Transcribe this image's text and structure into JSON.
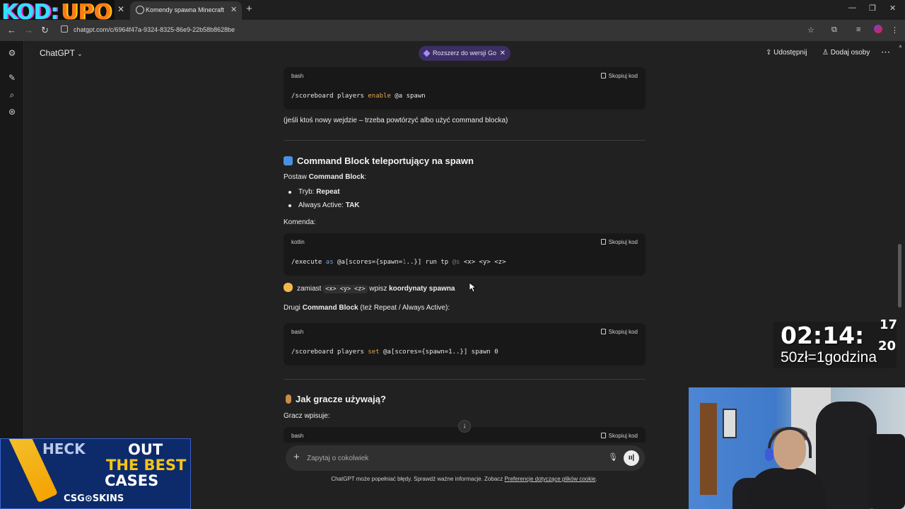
{
  "browser": {
    "overlay_logo_left": "KOD:",
    "overlay_logo_right": "UPO",
    "active_tab_title": "Komendy spawna Minecraft",
    "url": "chatgpt.com/c/6964f47a-9324-8325-86e9-22b58b8628be",
    "icons": [
      "back-icon",
      "forward-icon",
      "reload-icon",
      "star-icon",
      "extensions-icon",
      "media-icon",
      "profile-avatar",
      "menu-icon"
    ]
  },
  "header": {
    "app_title": "ChatGPT",
    "upgrade_label": "Rozszerz do wersji Go",
    "share_label": "Udostępnij",
    "add_people_label": "Dodaj osoby"
  },
  "content": {
    "code1": {
      "lang": "bash",
      "copy": "Skopiuj kod",
      "pre": "/scoreboard players ",
      "kw": "enable",
      "post": " @a spawn"
    },
    "note1": "(jeśli ktoś nowy wejdzie – trzeba powtórzyć albo użyć command blocka)",
    "heading1": "Command Block teleportujący na spawn",
    "set_label_pre": "Postaw ",
    "set_label_bold": "Command Block",
    "set_label_post": ":",
    "bullets": [
      {
        "label": "Tryb: ",
        "value": "Repeat"
      },
      {
        "label": "Always Active: ",
        "value": "TAK"
      }
    ],
    "command_label": "Komenda:",
    "code2": {
      "lang": "kotlin",
      "copy": "Skopiuj kod",
      "p1": "/execute ",
      "p2": "as",
      "p3": " @a[scores={spawn=",
      "p4": "1",
      "p5": "..}] run tp ",
      "p6": "@s",
      "p7": " <x> <y> <z>"
    },
    "hint_pre": "zamiast ",
    "hint_code": "<x> <y> <z>",
    "hint_mid": " wpisz ",
    "hint_bold": "koordynaty spawna",
    "second_pre": "Drugi ",
    "second_bold": "Command Block",
    "second_post": " (też Repeat / Always Active):",
    "code3": {
      "lang": "bash",
      "copy": "Skopiuj kod",
      "pre": "/scoreboard players ",
      "kw": "set",
      "post": " @a[scores={spawn=1..}] spawn 0"
    },
    "heading2": "Jak gracze używają?",
    "player_label": "Gracz wpisuje:",
    "code4": {
      "lang": "bash",
      "copy": "Skopiuj kod"
    }
  },
  "composer": {
    "placeholder": "Zapytaj o cokolwiek",
    "disclaimer_pre": "ChatGPT może popełniać błędy. Sprawdź ważne informacje. Zobacz ",
    "disclaimer_link": "Preferencje dotyczące plików cookie",
    "disclaimer_post": "."
  },
  "overlay": {
    "timer": "02:14:",
    "timer_sec_top": "17",
    "timer_sec_bottom": "20",
    "timer_sub": "50zł=1godzina",
    "ad_line1": "HECK",
    "ad_line2": "OUT",
    "ad_line3": "THE BEST",
    "ad_line4": "CASES",
    "ad_brand": "CSG⊙SKINS"
  },
  "colors": {
    "accent_upgrade": "#3b2f63",
    "keyword": "#e5a450",
    "bg": "#212121",
    "code_bg": "#181818"
  }
}
